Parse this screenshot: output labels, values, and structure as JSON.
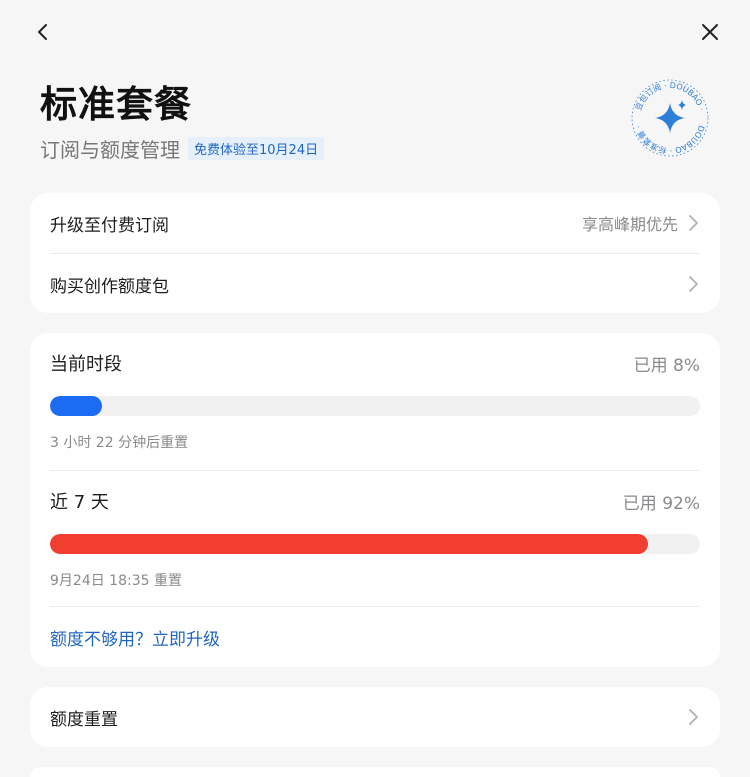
{
  "header": {
    "title": "标准套餐",
    "subtitle": "订阅与额度管理",
    "trial_badge": "免费体验至10月24日"
  },
  "seal": {
    "top_text": "豆包订阅 · DOUBAO ·",
    "bottom_text": "DOUBAO · 标准套餐 ·",
    "color": "#2d7fd8"
  },
  "actions": {
    "upgrade_label": "升级至付费订阅",
    "upgrade_hint": "享高峰期优先",
    "buy_pack_label": "购买创作额度包"
  },
  "usage": {
    "current": {
      "label": "当前时段",
      "used_text": "已用 8%",
      "used_fraction": 0.08,
      "bar_color": "#1b6cf2",
      "reset_text": "3 小时 22 分钟后重置"
    },
    "week": {
      "label": "近 7 天",
      "used_text": "已用 92%",
      "used_fraction": 0.92,
      "bar_color": "#f23d31",
      "reset_text": "9月24日 18:35 重置"
    },
    "upgrade_link": "额度不够用？立即升级"
  },
  "reset": {
    "label": "额度重置"
  },
  "colors": {
    "accent": "#1f66c2"
  }
}
